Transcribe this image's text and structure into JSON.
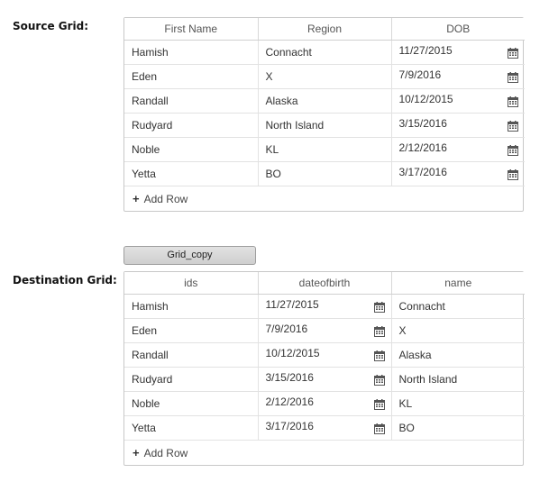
{
  "source": {
    "label": "Source Grid:",
    "columns": [
      "First Name",
      "Region",
      "DOB"
    ],
    "rows": [
      {
        "first_name": "Hamish",
        "region": "Connacht",
        "dob": "11/27/2015"
      },
      {
        "first_name": "Eden",
        "region": "X",
        "dob": "7/9/2016"
      },
      {
        "first_name": "Randall",
        "region": "Alaska",
        "dob": "10/12/2015"
      },
      {
        "first_name": "Rudyard",
        "region": "North Island",
        "dob": "3/15/2016"
      },
      {
        "first_name": "Noble",
        "region": "KL",
        "dob": "2/12/2016"
      },
      {
        "first_name": "Yetta",
        "region": "BO",
        "dob": "3/17/2016"
      }
    ],
    "add_row_label": "Add Row"
  },
  "copy_button": {
    "label": "Grid_copy"
  },
  "destination": {
    "label": "Destination Grid:",
    "columns": [
      "ids",
      "dateofbirth",
      "name"
    ],
    "rows": [
      {
        "ids": "Hamish",
        "dateofbirth": "11/27/2015",
        "name": "Connacht"
      },
      {
        "ids": "Eden",
        "dateofbirth": "7/9/2016",
        "name": "X"
      },
      {
        "ids": "Randall",
        "dateofbirth": "10/12/2015",
        "name": "Alaska"
      },
      {
        "ids": "Rudyard",
        "dateofbirth": "3/15/2016",
        "name": "North Island"
      },
      {
        "ids": "Noble",
        "dateofbirth": "2/12/2016",
        "name": "KL"
      },
      {
        "ids": "Yetta",
        "dateofbirth": "3/17/2016",
        "name": "BO"
      }
    ],
    "add_row_label": "Add Row"
  },
  "icons": {
    "date_picker": "calendar-icon",
    "add": "plus-icon"
  }
}
